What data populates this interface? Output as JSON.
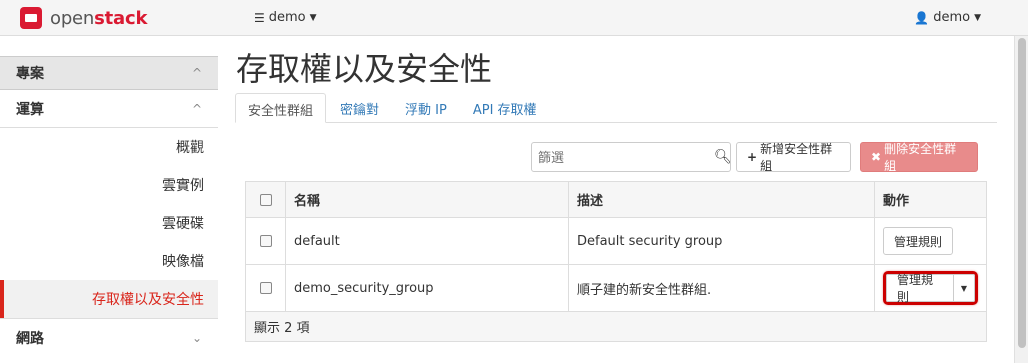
{
  "header": {
    "logo_prefix": "open",
    "logo_suffix": "stack",
    "project_icon": "list-icon",
    "project": "demo",
    "user_icon": "user-icon",
    "user": "demo"
  },
  "sidebar": {
    "project": "專案",
    "compute": "運算",
    "items": [
      {
        "label": "概觀"
      },
      {
        "label": "雲實例"
      },
      {
        "label": "雲硬碟"
      },
      {
        "label": "映像檔"
      },
      {
        "label": "存取權以及安全性",
        "active": true
      }
    ],
    "network": "網路"
  },
  "main": {
    "title": "存取權以及安全性",
    "tabs": [
      {
        "label": "安全性群組",
        "active": true
      },
      {
        "label": "密鑰對"
      },
      {
        "label": "浮動 IP"
      },
      {
        "label": "API 存取權"
      }
    ],
    "filter_placeholder": "篩選",
    "add_button": "新增安全性群組",
    "delete_button": "刪除安全性群組"
  },
  "table": {
    "headers": [
      "名稱",
      "描述",
      "動作"
    ],
    "rows": [
      {
        "name": "default",
        "description": "Default security group",
        "action": "管理規則"
      },
      {
        "name": "demo_security_group",
        "description": "順子建的新安全性群組.",
        "action": "管理規則"
      }
    ],
    "footer": "顯示 2 項"
  },
  "colors": {
    "accent": "#d9261c",
    "danger_button": "#e88b8b",
    "link": "#337ab7"
  }
}
